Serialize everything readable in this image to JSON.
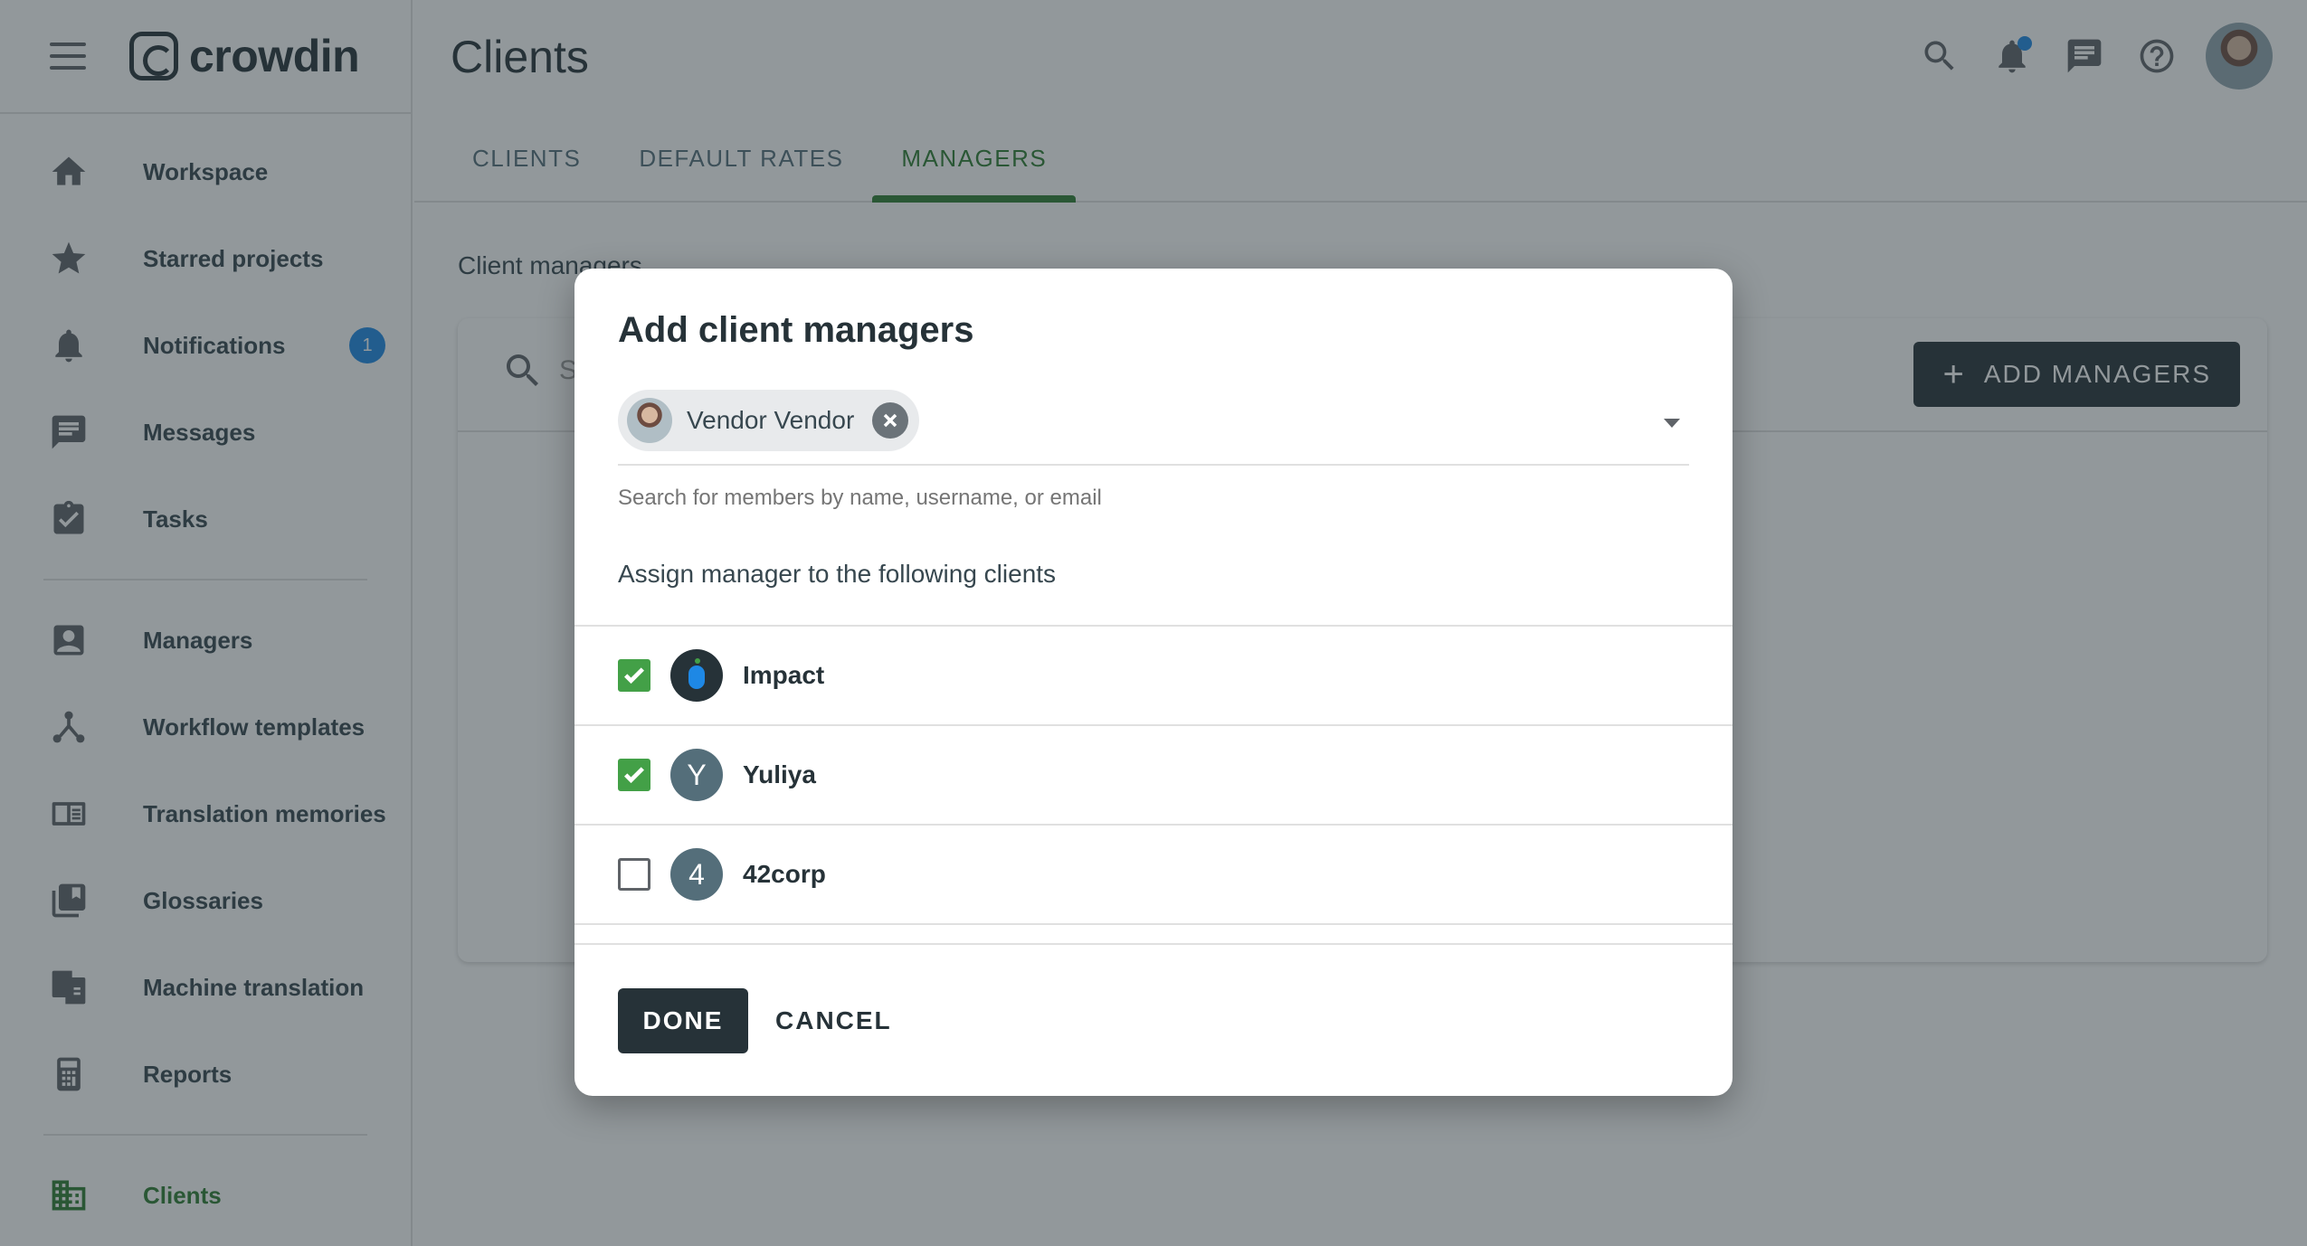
{
  "app": {
    "logo_text": "crowdin"
  },
  "sidebar": {
    "items": [
      {
        "label": "Workspace",
        "icon": "home-icon"
      },
      {
        "label": "Starred projects",
        "icon": "star-icon"
      },
      {
        "label": "Notifications",
        "icon": "bell-icon",
        "badge": "1"
      },
      {
        "label": "Messages",
        "icon": "message-icon"
      },
      {
        "label": "Tasks",
        "icon": "task-icon"
      },
      {
        "label": "Managers",
        "icon": "person-badge-icon"
      },
      {
        "label": "Workflow templates",
        "icon": "workflow-icon"
      },
      {
        "label": "Translation memories",
        "icon": "book-icon"
      },
      {
        "label": "Glossaries",
        "icon": "library-icon"
      },
      {
        "label": "Machine translation",
        "icon": "translate-icon"
      },
      {
        "label": "Reports",
        "icon": "calculator-icon"
      },
      {
        "label": "Clients",
        "icon": "building-icon",
        "active": true
      }
    ]
  },
  "header": {
    "title": "Clients"
  },
  "tabs": [
    {
      "label": "CLIENTS"
    },
    {
      "label": "DEFAULT RATES"
    },
    {
      "label": "MANAGERS",
      "active": true
    }
  ],
  "main": {
    "section_label": "Client managers",
    "search_placeholder": "S",
    "add_managers_label": "ADD MANAGERS"
  },
  "dialog": {
    "title": "Add client managers",
    "selected_member": "Vendor Vendor",
    "helper_text": "Search for members by name, username, or email",
    "assign_label": "Assign manager to the following clients",
    "clients": [
      {
        "name": "Impact",
        "initial": "",
        "checked": true
      },
      {
        "name": "Yuliya",
        "initial": "Y",
        "checked": true
      },
      {
        "name": "42corp",
        "initial": "4",
        "checked": false
      }
    ],
    "done_label": "DONE",
    "cancel_label": "CANCEL"
  },
  "colors": {
    "accent_green": "#2e7d32",
    "checkbox_green": "#43a047",
    "dark": "#263238",
    "badge_blue": "#1e88e5"
  }
}
